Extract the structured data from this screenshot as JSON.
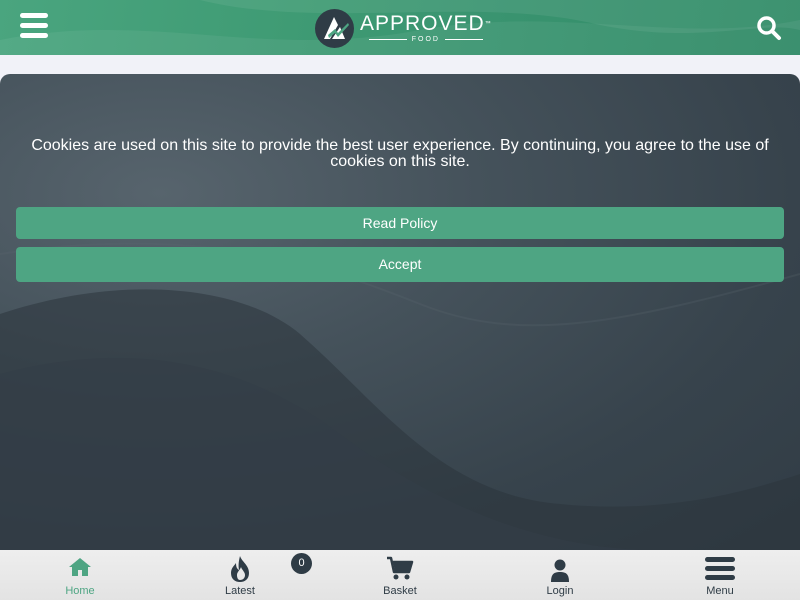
{
  "header": {
    "logo_word": "APPROVED",
    "logo_tm": "™",
    "logo_sub": "FOOD",
    "background_color": "#3e9a73"
  },
  "cookie_banner": {
    "message": "Cookies are used on this site to provide the best user experience. By continuing, you agree to the use of cookies on this site.",
    "read_policy_label": "Read Policy",
    "accept_label": "Accept",
    "button_color": "#4ea583",
    "background_color": "#3a464f"
  },
  "bottom_nav": {
    "items": [
      {
        "label": "Home",
        "icon": "home-icon",
        "active": true
      },
      {
        "label": "Latest",
        "icon": "flame-icon",
        "active": false
      },
      {
        "label": "Basket",
        "icon": "cart-icon",
        "active": false
      },
      {
        "label": "Login",
        "icon": "user-icon",
        "active": false
      },
      {
        "label": "Menu",
        "icon": "menu-icon",
        "active": false
      }
    ],
    "basket_count": "0",
    "active_color": "#4ea583",
    "text_color": "#2f3c46"
  }
}
